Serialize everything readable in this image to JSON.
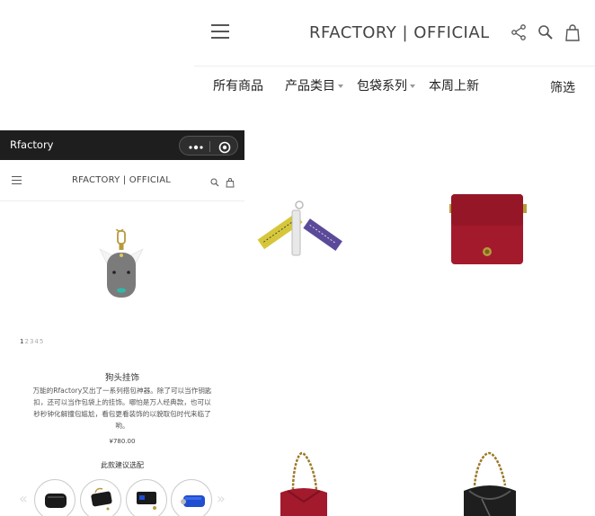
{
  "main_page": {
    "brand": "RFACTORY | OFFICIAL",
    "nav": [
      {
        "label": "所有商品"
      },
      {
        "label": "产品类目"
      },
      {
        "label": "包袋系列"
      },
      {
        "label": "本周上新"
      }
    ],
    "filter_label": "筛选"
  },
  "mini_program": {
    "title": "Rfactory",
    "brand": "RFACTORY | OFFICIAL",
    "pager": [
      "1",
      "2",
      "3",
      "4",
      "5"
    ],
    "pager_active": "1",
    "product": {
      "name": "狗头挂饰",
      "description": "万能的Rfactory又出了一系列搭包神器。除了可以当作钥匙扣，还可以当作包袋上的挂饰。哪怕是万人经典款，也可以秒秒钟化解撞包尴尬，看包更看装饰的以貌取包时代来临了哟。",
      "price": "¥780.00"
    },
    "suggest_label": "此款建议选配",
    "arrow_prev": "«",
    "arrow_next": "»"
  },
  "colors": {
    "wechat_bar": "#1e1e1e",
    "bag_red": "#a31a2c",
    "tag_yellow": "#d6c73a",
    "tag_purple": "#5b4a9a",
    "dog_grey": "#7b7b7b",
    "accessory_blue": "#1f4fd0"
  },
  "icons": {
    "menu": "hamburger-icon",
    "share": "share-icon",
    "search": "search-icon",
    "bag": "shopping-bag-icon",
    "more": "more-dots-icon",
    "close": "close-circle-icon"
  }
}
